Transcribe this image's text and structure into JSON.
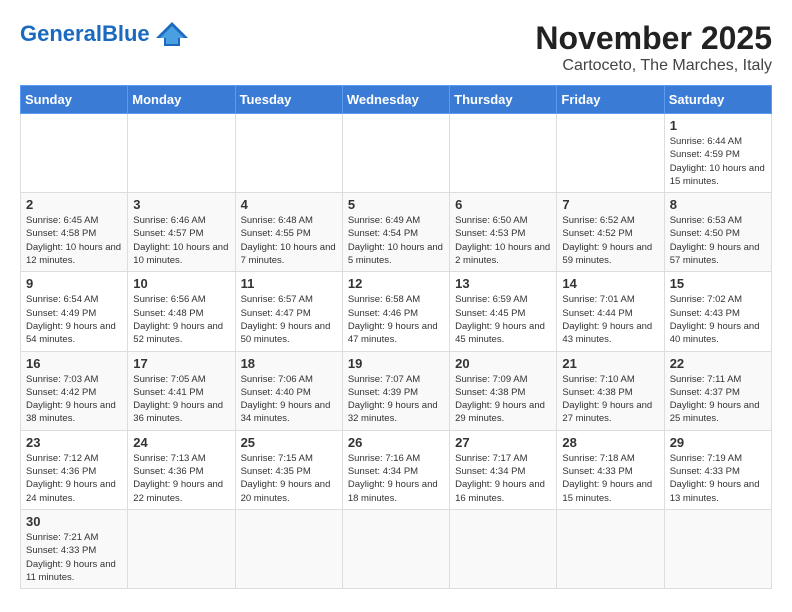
{
  "logo": {
    "general": "General",
    "blue": "Blue",
    "tagline": ""
  },
  "header": {
    "month": "November 2025",
    "location": "Cartoceto, The Marches, Italy"
  },
  "weekdays": [
    "Sunday",
    "Monday",
    "Tuesday",
    "Wednesday",
    "Thursday",
    "Friday",
    "Saturday"
  ],
  "days": {
    "1": {
      "sunrise": "6:44 AM",
      "sunset": "4:59 PM",
      "daylight": "10 hours and 15 minutes."
    },
    "2": {
      "sunrise": "6:45 AM",
      "sunset": "4:58 PM",
      "daylight": "10 hours and 12 minutes."
    },
    "3": {
      "sunrise": "6:46 AM",
      "sunset": "4:57 PM",
      "daylight": "10 hours and 10 minutes."
    },
    "4": {
      "sunrise": "6:48 AM",
      "sunset": "4:55 PM",
      "daylight": "10 hours and 7 minutes."
    },
    "5": {
      "sunrise": "6:49 AM",
      "sunset": "4:54 PM",
      "daylight": "10 hours and 5 minutes."
    },
    "6": {
      "sunrise": "6:50 AM",
      "sunset": "4:53 PM",
      "daylight": "10 hours and 2 minutes."
    },
    "7": {
      "sunrise": "6:52 AM",
      "sunset": "4:52 PM",
      "daylight": "9 hours and 59 minutes."
    },
    "8": {
      "sunrise": "6:53 AM",
      "sunset": "4:50 PM",
      "daylight": "9 hours and 57 minutes."
    },
    "9": {
      "sunrise": "6:54 AM",
      "sunset": "4:49 PM",
      "daylight": "9 hours and 54 minutes."
    },
    "10": {
      "sunrise": "6:56 AM",
      "sunset": "4:48 PM",
      "daylight": "9 hours and 52 minutes."
    },
    "11": {
      "sunrise": "6:57 AM",
      "sunset": "4:47 PM",
      "daylight": "9 hours and 50 minutes."
    },
    "12": {
      "sunrise": "6:58 AM",
      "sunset": "4:46 PM",
      "daylight": "9 hours and 47 minutes."
    },
    "13": {
      "sunrise": "6:59 AM",
      "sunset": "4:45 PM",
      "daylight": "9 hours and 45 minutes."
    },
    "14": {
      "sunrise": "7:01 AM",
      "sunset": "4:44 PM",
      "daylight": "9 hours and 43 minutes."
    },
    "15": {
      "sunrise": "7:02 AM",
      "sunset": "4:43 PM",
      "daylight": "9 hours and 40 minutes."
    },
    "16": {
      "sunrise": "7:03 AM",
      "sunset": "4:42 PM",
      "daylight": "9 hours and 38 minutes."
    },
    "17": {
      "sunrise": "7:05 AM",
      "sunset": "4:41 PM",
      "daylight": "9 hours and 36 minutes."
    },
    "18": {
      "sunrise": "7:06 AM",
      "sunset": "4:40 PM",
      "daylight": "9 hours and 34 minutes."
    },
    "19": {
      "sunrise": "7:07 AM",
      "sunset": "4:39 PM",
      "daylight": "9 hours and 32 minutes."
    },
    "20": {
      "sunrise": "7:09 AM",
      "sunset": "4:38 PM",
      "daylight": "9 hours and 29 minutes."
    },
    "21": {
      "sunrise": "7:10 AM",
      "sunset": "4:38 PM",
      "daylight": "9 hours and 27 minutes."
    },
    "22": {
      "sunrise": "7:11 AM",
      "sunset": "4:37 PM",
      "daylight": "9 hours and 25 minutes."
    },
    "23": {
      "sunrise": "7:12 AM",
      "sunset": "4:36 PM",
      "daylight": "9 hours and 24 minutes."
    },
    "24": {
      "sunrise": "7:13 AM",
      "sunset": "4:36 PM",
      "daylight": "9 hours and 22 minutes."
    },
    "25": {
      "sunrise": "7:15 AM",
      "sunset": "4:35 PM",
      "daylight": "9 hours and 20 minutes."
    },
    "26": {
      "sunrise": "7:16 AM",
      "sunset": "4:34 PM",
      "daylight": "9 hours and 18 minutes."
    },
    "27": {
      "sunrise": "7:17 AM",
      "sunset": "4:34 PM",
      "daylight": "9 hours and 16 minutes."
    },
    "28": {
      "sunrise": "7:18 AM",
      "sunset": "4:33 PM",
      "daylight": "9 hours and 15 minutes."
    },
    "29": {
      "sunrise": "7:19 AM",
      "sunset": "4:33 PM",
      "daylight": "9 hours and 13 minutes."
    },
    "30": {
      "sunrise": "7:21 AM",
      "sunset": "4:33 PM",
      "daylight": "9 hours and 11 minutes."
    }
  }
}
